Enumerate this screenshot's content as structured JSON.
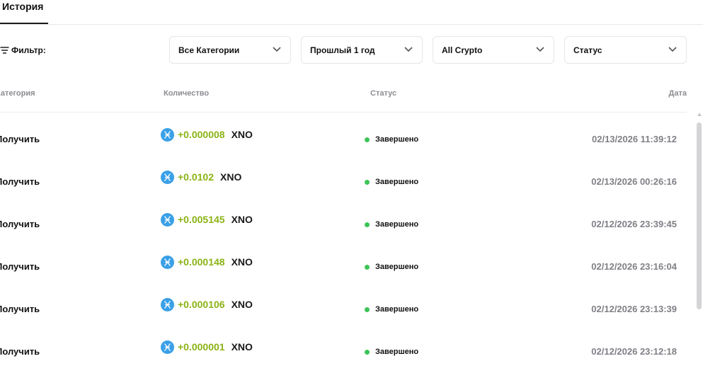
{
  "tabs": {
    "active_label": "История"
  },
  "filters": {
    "label": "Фильтр:",
    "category": "Все Категории",
    "period": "Прошлый 1 год",
    "crypto": "All Crypto",
    "status": "Статус"
  },
  "table": {
    "headers": {
      "category": "Категория",
      "amount": "Количество",
      "status": "Статус",
      "date": "Дата"
    },
    "rows": [
      {
        "category": "Получить",
        "amount": "+0.000008",
        "ticker": "XNO",
        "status": "Завершено",
        "date": "02/13/2026 11:39:12"
      },
      {
        "category": "Получить",
        "amount": "+0.0102",
        "ticker": "XNO",
        "status": "Завершено",
        "date": "02/13/2026 00:26:16"
      },
      {
        "category": "Получить",
        "amount": "+0.005145",
        "ticker": "XNO",
        "status": "Завершено",
        "date": "02/12/2026 23:39:45"
      },
      {
        "category": "Получить",
        "amount": "+0.000148",
        "ticker": "XNO",
        "status": "Завершено",
        "date": "02/12/2026 23:16:04"
      },
      {
        "category": "Получить",
        "amount": "+0.000106",
        "ticker": "XNO",
        "status": "Завершено",
        "date": "02/12/2026 23:13:39"
      },
      {
        "category": "Получить",
        "amount": "+0.000001",
        "ticker": "XNO",
        "status": "Завершено",
        "date": "02/12/2026 23:12:18"
      }
    ]
  },
  "icons": {
    "filter": "filter-icon",
    "dropdown": "chevron-down-icon",
    "coin": "nano-coin-icon",
    "status_dot": "status-dot-icon"
  },
  "colors": {
    "accent_amount": "#8bb315",
    "status_complete": "#3cc456",
    "coin": "#3aa0e8"
  }
}
